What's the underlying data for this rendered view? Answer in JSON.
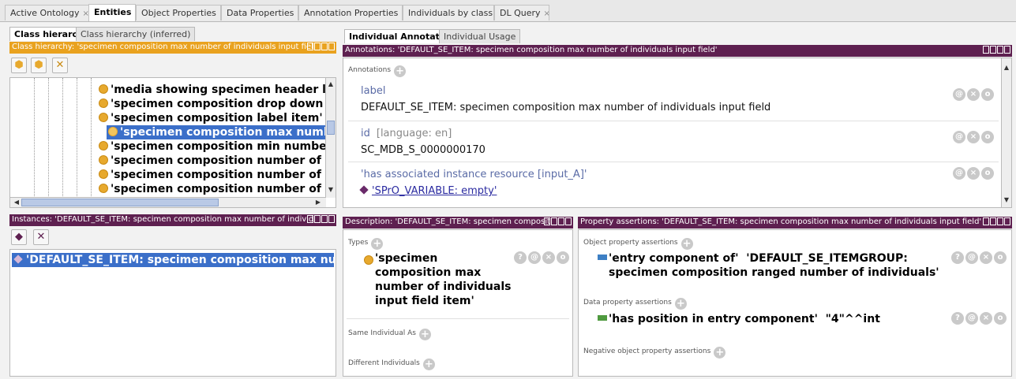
{
  "top_tabs": [
    {
      "label": "Active Ontology"
    },
    {
      "label": "Entities"
    },
    {
      "label": "Object Properties"
    },
    {
      "label": "Data Properties"
    },
    {
      "label": "Annotation Properties"
    },
    {
      "label": "Individuals by class"
    },
    {
      "label": "DL Query"
    }
  ],
  "close_glyph": "×",
  "class_hierarchy": {
    "tabs": [
      "Class hierarchy",
      "Class hierarchy (inferred)"
    ],
    "header": "Class hierarchy: 'specimen composition max number of individuals input fiel",
    "items": [
      "'media showing specimen header lal",
      "'specimen composition drop down it",
      "'specimen composition label item'",
      "'specimen composition max number",
      "'specimen composition min number",
      "'specimen composition number of in",
      "'specimen composition number of in",
      "'specimen composition number of in"
    ],
    "selected_index": 3
  },
  "instances": {
    "header": "Instances: 'DEFAULT_SE_ITEM: specimen composition max number of individ",
    "item": "'DEFAULT_SE_ITEM: specimen composition max nu"
  },
  "annotations": {
    "tabs": [
      "Individual Annotations",
      "Individual Usage"
    ],
    "header": "Annotations: 'DEFAULT_SE_ITEM: specimen composition max number of individuals input field'",
    "section_label": "Annotations",
    "rows": [
      {
        "property": "label",
        "lang": "",
        "value": "DEFAULT_SE_ITEM: specimen composition max number of individuals input field"
      },
      {
        "property": "id",
        "lang": "[language: en]",
        "value": "SC_MDB_S_0000000170"
      },
      {
        "property": "'has associated instance resource [input_A]'",
        "lang": "",
        "value": "'SPrO_VARIABLE: empty'"
      }
    ]
  },
  "description": {
    "header": "Description: 'DEFAULT_SE_ITEM: specimen composit",
    "types_label": "Types",
    "type_lines": [
      "'specimen",
      "composition max",
      "number of individuals",
      "input field item'"
    ],
    "same_label": "Same Individual As",
    "different_label": "Different Individuals"
  },
  "property_assertions": {
    "header": "Property assertions: 'DEFAULT_SE_ITEM: specimen composition max number of individuals input field'",
    "object_label": "Object property assertions",
    "object_line1_prop": "'entry component of'",
    "object_line1_val": "'DEFAULT_SE_ITEMGROUP:",
    "object_line2": "specimen composition ranged number of individuals'",
    "data_label": "Data property assertions",
    "data_prop": "'has position in entry component'",
    "data_val": "\"4\"^^int",
    "negative_label": "Negative object property assertions"
  },
  "colors": {
    "orange_header": "#e9a21f",
    "purple_header": "#5e2050",
    "selection": "#3b6fc9",
    "object_prop": "#3d7fc4",
    "data_prop": "#4f9a3f"
  }
}
